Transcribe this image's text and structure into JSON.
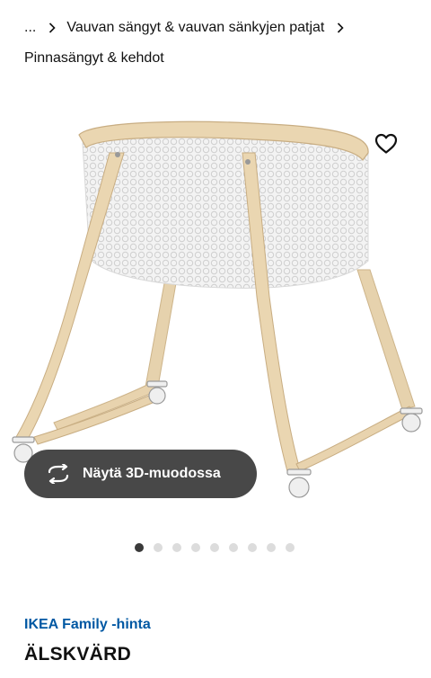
{
  "breadcrumb": {
    "ellipsis": "...",
    "category": "Vauvan sängyt & vauvan sänkyjen patjat",
    "current": "Pinnasängyt & kehdot"
  },
  "product": {
    "image_description": "ÄLSKVÄRD",
    "favourite_icon": "heart-outline-icon",
    "view_3d_label": "Näytä 3D-muodossa",
    "view_3d_icon": "rotate-3d-icon",
    "carousel": {
      "total": 9,
      "active_index": 0
    },
    "family_price_label": "IKEA Family -hinta",
    "name": "ÄLSKVÄRD"
  },
  "colors": {
    "accent_blue": "#0058a3",
    "button_dark": "#484848",
    "wood": "#e8d3ae"
  }
}
